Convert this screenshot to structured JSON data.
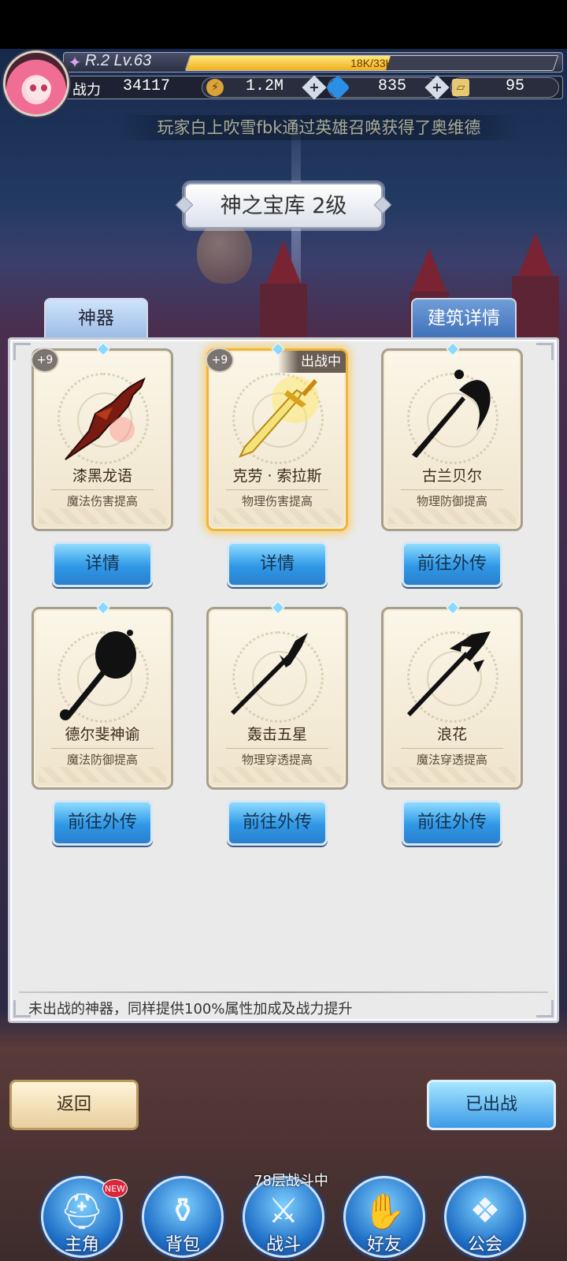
{
  "hud": {
    "level": "R.2 Lv.63",
    "exp_text": "18K/33K",
    "exp_progress": 0.545,
    "power_label": "战力",
    "power_value": "34117",
    "gold": "1.2M",
    "diamonds": "835",
    "tickets": "95"
  },
  "marquee": "玩家白上吹雪fbk通过英雄召唤获得了奥维德",
  "title": "神之宝库 2级",
  "tabs": {
    "artifact": "神器",
    "building": "建筑详情"
  },
  "cards": [
    {
      "name": "漆黑龙语",
      "desc": "魔法伤害提高",
      "plus": "+9",
      "button": "详情"
    },
    {
      "name": "克劳 · 索拉斯",
      "desc": "物理伤害提高",
      "plus": "+9",
      "status": "出战中",
      "button": "详情"
    },
    {
      "name": "古兰贝尔",
      "desc": "物理防御提高",
      "button": "前往外传"
    },
    {
      "name": "德尔斐神谕",
      "desc": "魔法防御提高",
      "button": "前往外传"
    },
    {
      "name": "轰击五星",
      "desc": "物理穿透提高",
      "button": "前往外传"
    },
    {
      "name": "浪花",
      "desc": "魔法穿透提高",
      "button": "前往外传"
    }
  ],
  "footer_note": "未出战的神器，同样提供100%属性加成及战力提升",
  "buttons": {
    "back": "返回",
    "deployed": "已出战"
  },
  "floor_status": "78层战斗中",
  "nav": {
    "new_badge": "NEW",
    "items": [
      {
        "label": "主角",
        "icon": "helmet-icon"
      },
      {
        "label": "背包",
        "icon": "backpack-icon"
      },
      {
        "label": "战斗",
        "icon": "crossed-swords-icon"
      },
      {
        "label": "好友",
        "icon": "handshake-icon"
      },
      {
        "label": "公会",
        "icon": "guild-crest-icon"
      }
    ]
  }
}
